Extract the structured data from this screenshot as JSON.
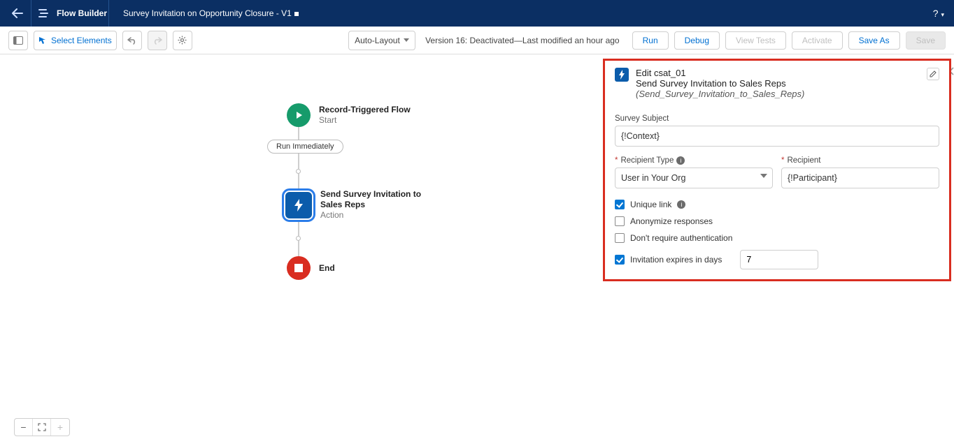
{
  "header": {
    "app_title": "Flow Builder",
    "flow_name": "Survey Invitation on Opportunity Closure - V1",
    "help_label": "?"
  },
  "toolbar": {
    "select_elements": "Select Elements",
    "auto_layout": "Auto-Layout",
    "version_text": "Version 16: Deactivated—Last modified an hour ago",
    "run": "Run",
    "debug": "Debug",
    "view_tests": "View Tests",
    "activate": "Activate",
    "save_as": "Save As",
    "save": "Save"
  },
  "flow": {
    "start_title": "Record-Triggered Flow",
    "start_sub": "Start",
    "run_immediately": "Run Immediately",
    "action_title": "Send Survey Invitation to Sales Reps",
    "action_sub": "Action",
    "end_label": "End"
  },
  "panel": {
    "edit_prefix": "Edit csat_01",
    "subtitle_text": "Send Survey Invitation to Sales Reps",
    "subtitle_api": "(Send_Survey_Invitation_to_Sales_Reps)",
    "survey_subject_label": "Survey Subject",
    "survey_subject_value": "{!Context}",
    "recipient_type_label": "Recipient Type",
    "recipient_type_value": "User in Your Org",
    "recipient_label": "Recipient",
    "recipient_value": "{!Participant}",
    "unique_link": "Unique link",
    "anonymize": "Anonymize responses",
    "no_auth": "Don't require authentication",
    "expires_label": "Invitation expires in days",
    "expires_value": "7"
  },
  "zoom": {
    "minus": "−",
    "fit": "⤢",
    "plus": "+"
  }
}
